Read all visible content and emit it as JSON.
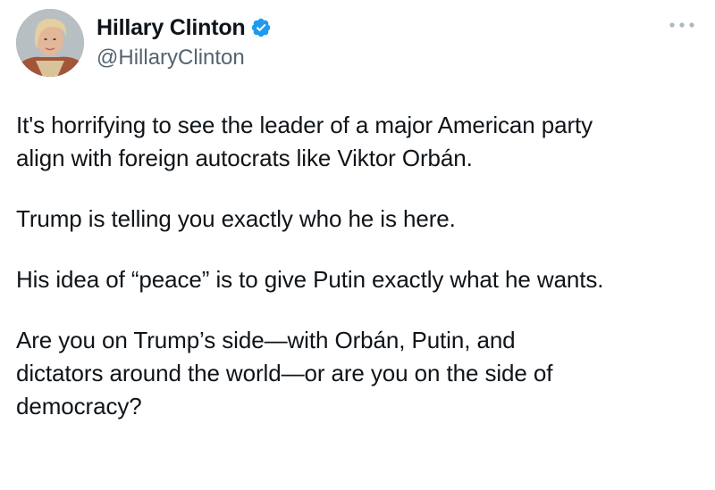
{
  "author": {
    "display_name": "Hillary Clinton",
    "handle": "@HillaryClinton",
    "verified_icon": "verified-badge-icon",
    "avatar_icon": "profile-photo"
  },
  "menu": {
    "icon": "more-dots-icon"
  },
  "tweet": {
    "paragraphs": [
      "It's horrifying to see the leader of a major American party\nalign with foreign autocrats like Viktor Orbán.",
      "Trump is telling you exactly who he is here.",
      "His idea of “peace” is to give Putin exactly what he wants.",
      "Are you on Trump’s side—with Orbán, Putin, and\ndictators around the world—or are you on the side of\ndemocracy?"
    ]
  },
  "colors": {
    "text": "#0f1419",
    "secondary": "#536471",
    "verified": "#1d9bf0",
    "menu_dots": "#aab8c2"
  }
}
